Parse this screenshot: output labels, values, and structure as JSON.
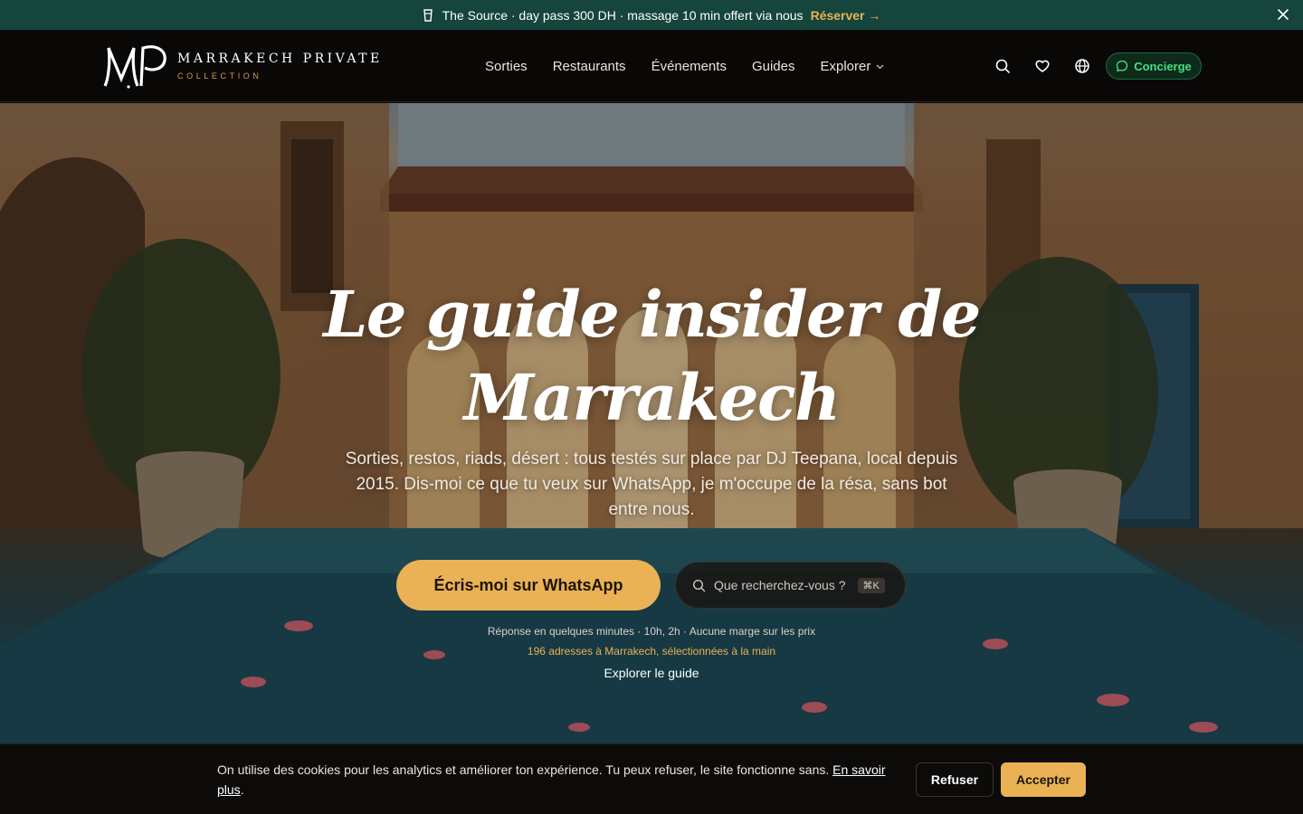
{
  "promo": {
    "text": "The Source · day pass 300 DH · massage 10 min offert via nous",
    "link_label": "Réserver →",
    "icon": "cup-icon"
  },
  "header": {
    "logo_mark": "MP",
    "logo_title": "MARRAKECH PRIVATE",
    "logo_subtitle": "COLLECTION",
    "nav": [
      "Sorties",
      "Restaurants",
      "Événements",
      "Guides"
    ],
    "nav_dropdown": "Explorer",
    "concierge_label": "Concierge",
    "icons": [
      "search-icon",
      "heart-icon",
      "globe-icon",
      "chat-icon"
    ]
  },
  "hero": {
    "title_line1": "Le guide insider de",
    "title_line2": "Marrakech",
    "subtitle": "Sorties, restos, riads, désert : tous testés sur place par DJ Teepana, local depuis 2015. Dis-moi ce que tu veux sur WhatsApp, je m'occupe de la résa, sans bot entre nous.",
    "cta_label": "Écris-moi sur WhatsApp",
    "search_placeholder": "Que recherchez-vous ?",
    "search_shortcut": "⌘K",
    "note": "Réponse en quelques minutes · 10h, 2h · Aucune marge sur les prix",
    "count": "196 adresses à Marrakech, sélectionnées à la main",
    "explore_label": "Explorer le guide"
  },
  "cookie": {
    "text": "On utilise des cookies pour les analytics et améliorer ton expérience. Tu peux refuser, le site fonctionne sans.",
    "more_label": "En savoir plus",
    "end_punct": ".",
    "refuse_label": "Refuser",
    "accept_label": "Accepter"
  },
  "colors": {
    "accent": "#eab254",
    "promo_bg": "#15453d",
    "concierge_green": "#4ade80"
  }
}
